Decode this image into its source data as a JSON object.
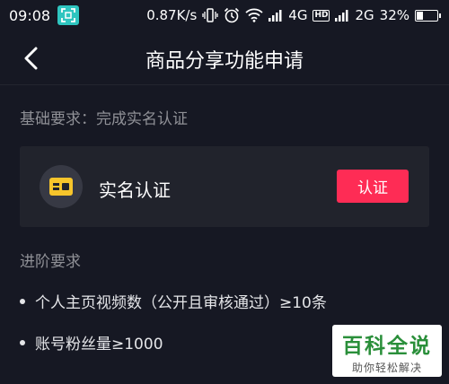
{
  "status_bar": {
    "time": "09:08",
    "speed": "0.87K/s",
    "network1": "4G",
    "network2": "2G",
    "hd": "HD",
    "battery_percent": "32%",
    "battery_level": 0.32
  },
  "header": {
    "title": "商品分享功能申请"
  },
  "basic": {
    "label": "基础要求：完成实名认证"
  },
  "auth_card": {
    "title": "实名认证",
    "button_label": "认证",
    "icon": "id-card-icon"
  },
  "advanced": {
    "label": "进阶要求",
    "items": [
      {
        "text": "个人主页视频数（公开且审核通过）≥10条"
      },
      {
        "text": "账号粉丝量≥1000"
      }
    ]
  },
  "watermark": {
    "main": "百科全说",
    "sub": "助你轻松解决"
  },
  "colors": {
    "background": "#161823",
    "card": "#21232c",
    "accent": "#fe2c55",
    "icon_yellow": "#f7c52b",
    "muted_text": "#8f9096"
  }
}
